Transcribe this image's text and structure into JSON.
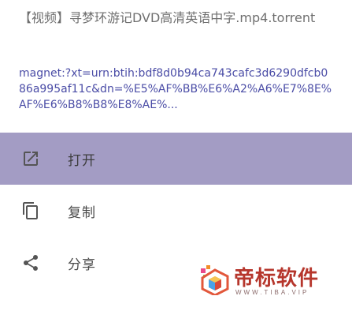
{
  "sheet": {
    "file_name": "【视频】寻梦环游记DVD高清英语中字.mp4.torrent",
    "magnet_link": "magnet:?xt=urn:btih:bdf8d0b94ca743cafc3d6290dfcb086a995af11c&dn=%E5%AF%BB%E6%A2%A6%E7%8E%AF%E6%B8%B8%E8%AE%..."
  },
  "menu": {
    "items": [
      {
        "label": "打开",
        "icon": "open-in-new-icon",
        "selected": true
      },
      {
        "label": "复制",
        "icon": "copy-icon",
        "selected": false
      },
      {
        "label": "分享",
        "icon": "share-icon",
        "selected": false
      }
    ]
  },
  "colors": {
    "selected_bg": "#a39cc4",
    "link_text": "#4a4ca6",
    "icon": "#555555",
    "watermark_red": "#b6362c"
  },
  "watermark": {
    "title": "帝标软件",
    "url": "WWW.TIBA.VIP"
  }
}
